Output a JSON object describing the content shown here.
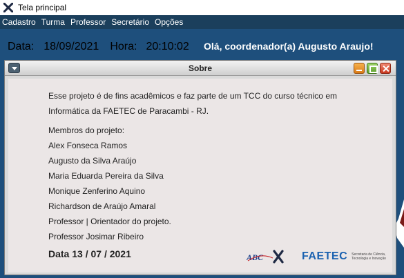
{
  "window": {
    "title": "Tela principal",
    "icon": "x-logo-icon"
  },
  "menubar": {
    "items": [
      "Cadastro",
      "Turma",
      "Professor",
      "Secretário",
      "Opções"
    ]
  },
  "infobar": {
    "date_label": "Data:",
    "date_value": "18/09/2021",
    "time_label": "Hora:",
    "time_value": "20:10:02",
    "greeting": "Olá, coordenador(a) Augusto Araujo!"
  },
  "about": {
    "title": "Sobre",
    "description_line1": "Esse projeto é de fins acadêmicos e faz parte de um TCC do curso técnico em",
    "description_line2": "Informática da FAETEC de Paracambi - RJ.",
    "members_heading": "Membros do projeto:",
    "members": [
      "Alex Fonseca Ramos",
      "Augusto da Silva Araújo",
      "Maria Eduarda Pereira da Silva",
      "Monique Zenferino Aquino",
      "Richardson de Araújo Amaral"
    ],
    "advisor_note": "Professor | Orientador do projeto.",
    "advisor_name": "Professor Josimar Ribeiro",
    "date_line": "Data 13 / 07 / 2021",
    "logo_abcx_text": "ABCX",
    "logo_faetec_text": "FAETEC",
    "logo_faetec_sub": "Secretaria de Ciência, Tecnologia e Inovação"
  },
  "colors": {
    "menubar": "#1b3f5c",
    "main_background": "#1e4f7c",
    "faetec_blue": "#1b62b0"
  }
}
